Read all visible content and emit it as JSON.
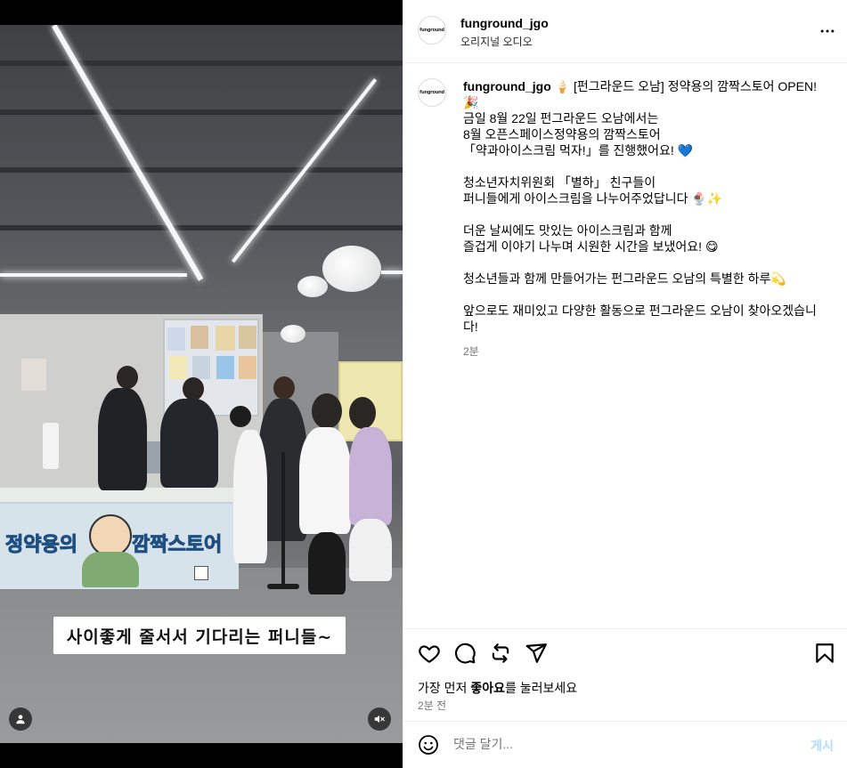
{
  "header": {
    "username": "funground_jgo",
    "audio_label": "오리지널 오디오",
    "avatar_logo_text": "funground"
  },
  "media": {
    "caption": "사이좋게 줄서서 기다리는 퍼니들~",
    "banner_title_left": "정약용의",
    "banner_title_right": "깜짝스토어",
    "icons": {
      "user": "user-icon",
      "mute": "speaker-muted-icon"
    }
  },
  "post": {
    "username": "funground_jgo",
    "lines": [
      "🍦 [펀그라운드 오남] 정약용의 깜짝스토어 OPEN!",
      "🎉",
      "금일 8월 22일 펀그라운드 오남에서는",
      "8월 오픈스페이스정약용의 깜짝스토어",
      "「약과아이스크림 먹자!」를 진행했어요! 💙",
      "",
      "청소년자치위원회 「별하」 친구들이",
      "퍼니들에게 아이스크림을 나누어주었답니다 🍨✨",
      "",
      "더운 날씨에도 맛있는 아이스크림과 함께",
      "즐겁게 이야기 나누며 시원한 시간을 보냈어요! 😋",
      "",
      "청소년들과 함께 만들어가는 펀그라운드 오남의 특별한 하루💫",
      "",
      "앞으로도 재미있고 다양한 활동으로 펀그라운드 오남이 찾아오겠습니",
      "다!"
    ],
    "time": "2분"
  },
  "actions": {
    "icons": [
      "heart-icon",
      "comment-icon",
      "share-icon",
      "send-icon",
      "bookmark-icon"
    ],
    "likes_prefix": "가장 먼저 ",
    "likes_bold": "좋아요",
    "likes_suffix": "를 눌러보세요",
    "ago": "2분 전"
  },
  "comment_bar": {
    "placeholder": "댓글 달기...",
    "post_label": "게시",
    "post_color": "#b3dbff"
  }
}
